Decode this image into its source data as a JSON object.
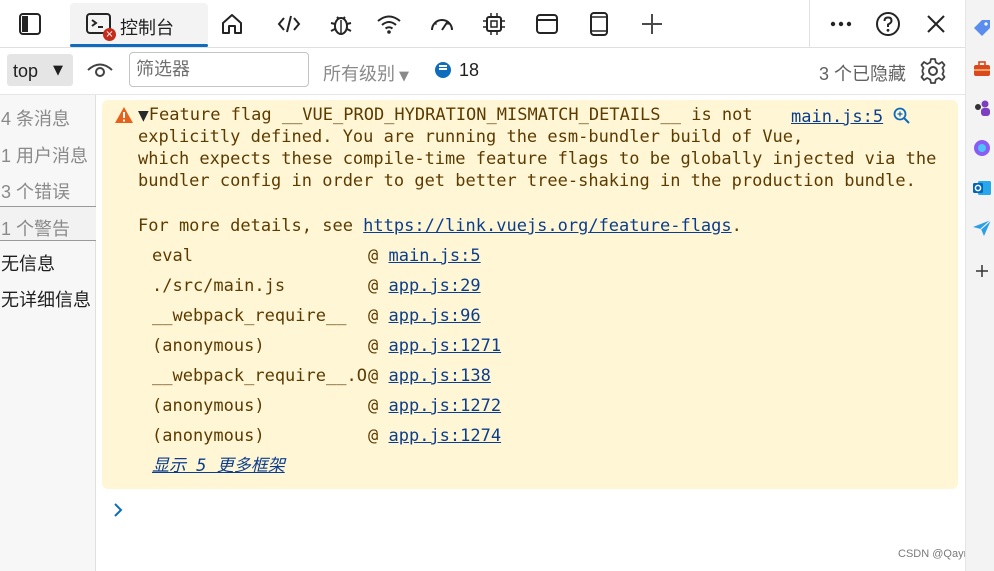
{
  "tabs": {
    "console_label": "控制台",
    "error_badge": "×"
  },
  "toolbar": {
    "context_value": "top",
    "filter_placeholder": "筛选器",
    "levels_label": "所有级别",
    "message_count": "18",
    "hidden_label": "3 个已隐藏"
  },
  "sidebar": {
    "items": [
      {
        "label": "4 条消息"
      },
      {
        "label": "1 用户消息"
      },
      {
        "label": "3 个错误"
      },
      {
        "label": "1 个警告"
      },
      {
        "label": "无信息"
      },
      {
        "label": "无详细信息"
      }
    ]
  },
  "warning": {
    "line1": "Feature flag __VUE_PROD_HYDRATION_MISMATCH_DETAILS__ is not",
    "line2": "explicitly defined. You are running the esm-bundler build of Vue,",
    "line3": "which expects these compile-time feature flags to be globally injected via the",
    "line4": "bundler config in order to get better tree-shaking in the production bundle.",
    "details_prefix": "For more details, see ",
    "details_url": "https://link.vuejs.org/feature-flags",
    "details_suffix": ".",
    "source": "main.js:5",
    "at_symbol": "@",
    "stack": [
      {
        "fn": "eval",
        "loc": "main.js:5"
      },
      {
        "fn": "./src/main.js",
        "loc": "app.js:29"
      },
      {
        "fn": "__webpack_require__",
        "loc": "app.js:96"
      },
      {
        "fn": "(anonymous)",
        "loc": "app.js:1271"
      },
      {
        "fn": "__webpack_require__.O",
        "loc": "app.js:138"
      },
      {
        "fn": "(anonymous)",
        "loc": "app.js:1272"
      },
      {
        "fn": "(anonymous)",
        "loc": "app.js:1274"
      }
    ],
    "show_more": "显示 5 更多框架"
  },
  "watermark": "CSDN @Qayrup",
  "colors": {
    "accent": "#0f6cbd",
    "warning_bg": "#fff6d6",
    "warning_text": "#5c3b00",
    "warning_icon": "#e8611a",
    "error": "#c42b1c"
  }
}
